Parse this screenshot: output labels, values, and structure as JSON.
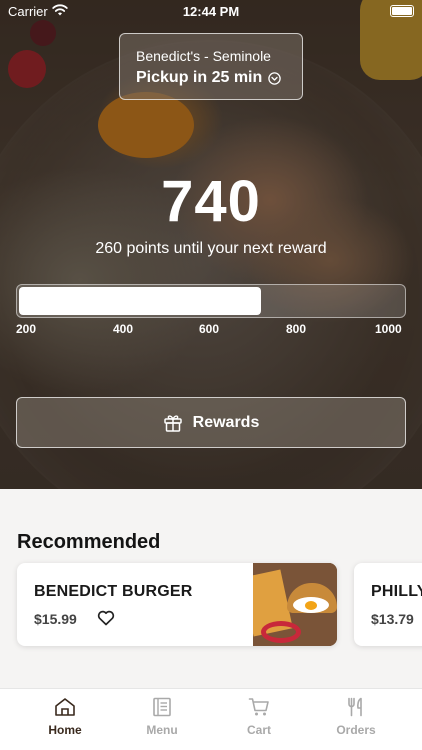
{
  "status_bar": {
    "carrier": "Carrier",
    "time": "12:44 PM"
  },
  "location": {
    "name": "Benedict's - Seminole",
    "pickup": "Pickup in 25 min"
  },
  "rewards": {
    "points": "740",
    "caption": "260 points until your next reward",
    "progress_fraction": 0.63,
    "ticks": [
      "200",
      "400",
      "600",
      "800",
      "1000"
    ],
    "button_label": "Rewards"
  },
  "recommended": {
    "title": "Recommended",
    "items": [
      {
        "name": "BENEDICT BURGER",
        "price": "$15.99"
      },
      {
        "name": "PHILLY",
        "price": "$13.79"
      }
    ]
  },
  "tabs": [
    {
      "label": "Home",
      "icon": "home-icon",
      "active": true
    },
    {
      "label": "Menu",
      "icon": "menu-book-icon",
      "active": false
    },
    {
      "label": "Cart",
      "icon": "cart-icon",
      "active": false
    },
    {
      "label": "Orders",
      "icon": "fork-knife-icon",
      "active": false
    }
  ],
  "colors": {
    "active_tab": "#3a2a1e",
    "inactive_tab": "#a9a9a9"
  }
}
